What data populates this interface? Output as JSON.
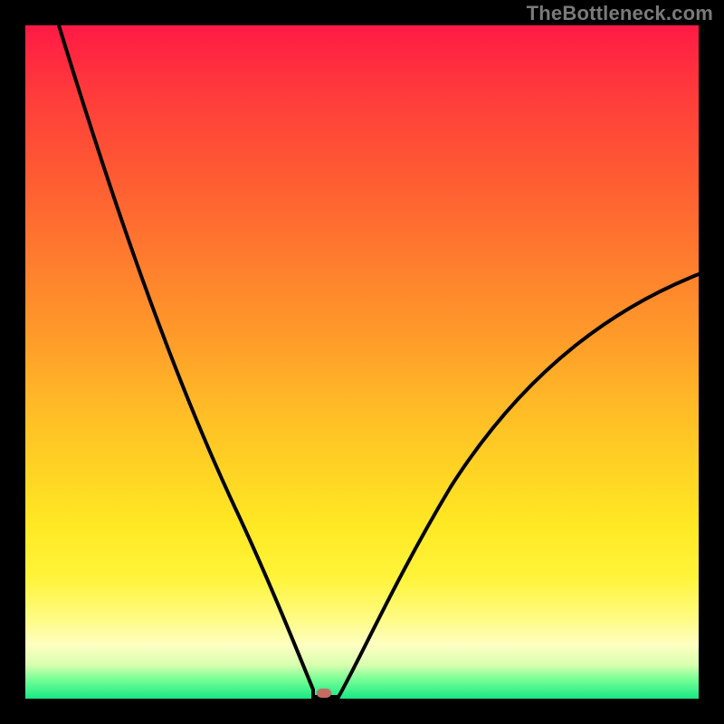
{
  "watermark": "TheBottleneck.com",
  "chart_data": {
    "type": "line",
    "title": "",
    "xlabel": "",
    "ylabel": "",
    "xlim": [
      0,
      100
    ],
    "ylim": [
      0,
      100
    ],
    "grid": false,
    "legend": false,
    "annotations": [
      {
        "type": "marker",
        "x": 44,
        "y": 0,
        "color": "#c66a64"
      }
    ],
    "series": [
      {
        "name": "bottleneck-curve",
        "color": "#000000",
        "x": [
          5,
          10,
          15,
          20,
          25,
          30,
          35,
          40,
          42,
          44,
          46,
          48,
          50,
          55,
          60,
          65,
          70,
          75,
          80,
          85,
          90,
          95,
          100
        ],
        "y": [
          100,
          88,
          75,
          62,
          49,
          36,
          24,
          10,
          2,
          0,
          0,
          3,
          7,
          15,
          23,
          30,
          36,
          42,
          47,
          52,
          56,
          60,
          63
        ]
      }
    ],
    "background_gradient": {
      "top": "#ff1a45",
      "middle": "#ffd324",
      "bottom": "#17e884"
    }
  }
}
